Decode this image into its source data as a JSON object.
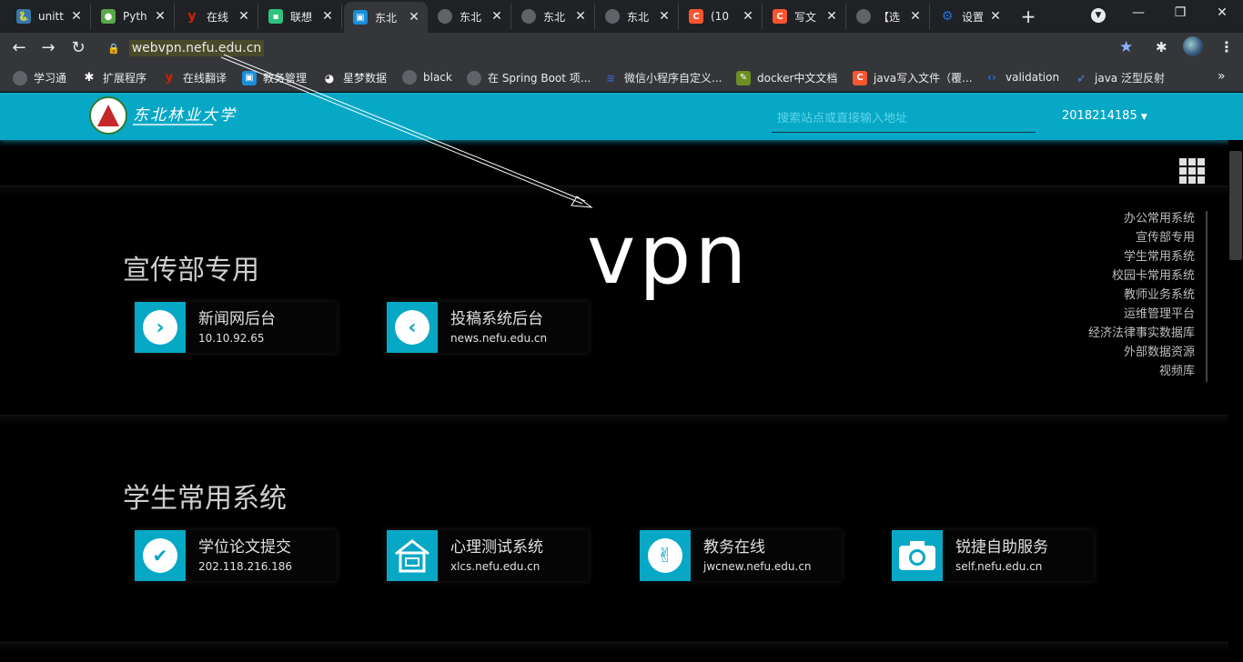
{
  "browser": {
    "tabs": [
      {
        "label": "unitt",
        "icon": "python-icon",
        "color": "#3776ab"
      },
      {
        "label": "Pyth",
        "icon": "python-robot-icon",
        "color": "#57a84a"
      },
      {
        "label": "在线",
        "icon": "youdao-icon",
        "color": "#d81e06"
      },
      {
        "label": "联想",
        "icon": "lenovo-icon",
        "color": "#2ec27e"
      },
      {
        "label": "东北",
        "icon": "nefu-icon",
        "color": "#1a8fd8"
      },
      {
        "label": "东北",
        "icon": "globe-icon",
        "color": "#5f6368"
      },
      {
        "label": "东北",
        "icon": "globe-icon",
        "color": "#5f6368"
      },
      {
        "label": "东北",
        "icon": "globe-icon",
        "color": "#5f6368"
      },
      {
        "label": "(10",
        "icon": "csdn-icon",
        "color": "#fc5531"
      },
      {
        "label": "写文",
        "icon": "csdn-icon",
        "color": "#fc5531"
      },
      {
        "label": "【选",
        "icon": "globe-icon",
        "color": "#5f6368"
      },
      {
        "label": "设置",
        "icon": "gear-icon",
        "color": "#1a73e8"
      }
    ],
    "new_tab": "+",
    "tab_close": "✕",
    "window_buttons": {
      "minimize": "—",
      "restore": "❐",
      "close": "✕"
    },
    "url": "webvpn.nefu.edu.cn",
    "bookmarks": [
      {
        "label": "学习通",
        "color": "#5f6368"
      },
      {
        "label": "扩展程序",
        "color": "#5f6368"
      },
      {
        "label": "在线翻译",
        "color": "#d81e06"
      },
      {
        "label": "教务管理",
        "color": "#1a8fd8"
      },
      {
        "label": "星梦数据",
        "color": "#5f6368"
      },
      {
        "label": "black",
        "color": "#5f6368"
      },
      {
        "label": "在 Spring Boot 项...",
        "color": "#5f6368"
      },
      {
        "label": "微信小程序自定义...",
        "color": "#3b5cc4"
      },
      {
        "label": "docker中文文档",
        "color": "#6c8e23"
      },
      {
        "label": "java写入文件（覆...",
        "color": "#fc5531"
      },
      {
        "label": "validation",
        "color": "#1a73e8"
      },
      {
        "label": "java 泛型反射",
        "color": "#4b8bf5"
      }
    ],
    "bookmarks_more": "»"
  },
  "header": {
    "logo_text": "东北林业大学",
    "search_placeholder": "搜索站点或直接输入地址",
    "username": "2018214185"
  },
  "overlay_text": "vpn",
  "sections": [
    {
      "title": "宣传部专用",
      "cards": [
        {
          "title": "新闻网后台",
          "url": "10.10.92.65",
          "icon": "chevron-right-icon"
        },
        {
          "title": "投稿系统后台",
          "url": "news.nefu.edu.cn",
          "icon": "chevron-left-icon"
        }
      ]
    },
    {
      "title": "学生常用系统",
      "cards": [
        {
          "title": "学位论文提交",
          "url": "202.118.216.186",
          "icon": "check-circle-icon"
        },
        {
          "title": "心理测试系统",
          "url": "xlcs.nefu.edu.cn",
          "icon": "house-icon"
        },
        {
          "title": "教务在线",
          "url": "jwcnew.nefu.edu.cn",
          "icon": "peace-hand-icon"
        },
        {
          "title": "锐捷自助服务",
          "url": "self.nefu.edu.cn",
          "icon": "camera-icon"
        }
      ]
    }
  ],
  "side_nav": [
    "办公常用系统",
    "宣传部专用",
    "学生常用系统",
    "校园卡常用系统",
    "教师业务系统",
    "运维管理平台",
    "经济法律事实数据库",
    "外部数据资源",
    "视频库"
  ],
  "colors": {
    "accent": "#07a8c6",
    "background": "#000000"
  }
}
